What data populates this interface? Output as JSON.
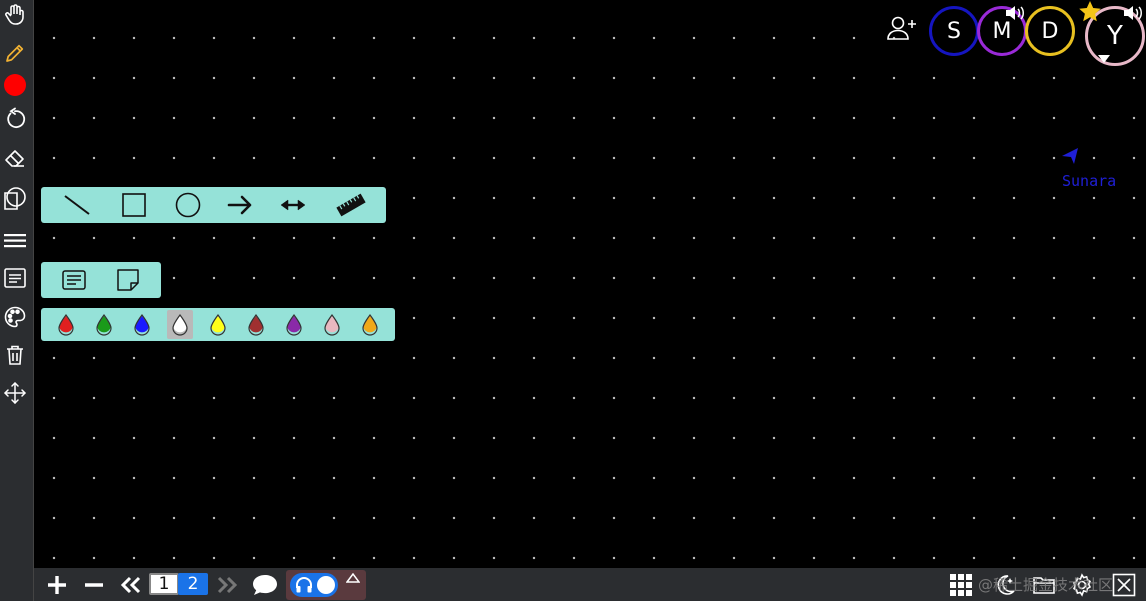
{
  "canvas": {
    "background": "#000000",
    "dot_color": "#bfbfbf"
  },
  "left_toolbar": {
    "items": [
      {
        "name": "hand-icon"
      },
      {
        "name": "pencil-icon"
      },
      {
        "name": "color-dot-icon",
        "color": "#ff0000"
      },
      {
        "name": "undo-icon"
      },
      {
        "name": "eraser-icon"
      },
      {
        "name": "shapes-icon"
      },
      {
        "name": "stroke-width-icon"
      },
      {
        "name": "text-icon"
      },
      {
        "name": "palette-icon"
      },
      {
        "name": "trash-icon"
      },
      {
        "name": "move-icon"
      }
    ]
  },
  "shapes_panel": {
    "background": "#95e2d8",
    "tools": [
      "line-icon",
      "rectangle-icon",
      "circle-icon",
      "arrow-icon",
      "double-arrow-icon",
      "ruler-icon"
    ]
  },
  "notes_panel": {
    "tools": [
      "text-note-icon",
      "sticky-note-icon"
    ]
  },
  "colors_panel": {
    "selected": "#ffffff",
    "colors": [
      "#e02020",
      "#1a9a1a",
      "#1a1aff",
      "#ffffff",
      "#ffff1a",
      "#a03030",
      "#8a2aa8",
      "#e8b8c0",
      "#f0a818"
    ]
  },
  "remote_cursor": {
    "name": "Sunara",
    "color": "#1f1fd6"
  },
  "participants": [
    {
      "initial": "S",
      "border": "#1515c0"
    },
    {
      "initial": "M",
      "border": "#9a2ad8"
    },
    {
      "initial": "D",
      "border": "#e8c020"
    },
    {
      "initial": "Y",
      "border": "#e8b8c8"
    }
  ],
  "bottom_bar": {
    "pages": [
      "1",
      "2"
    ],
    "current_page": "2",
    "watermark": "@稀土掘金技术社区"
  }
}
